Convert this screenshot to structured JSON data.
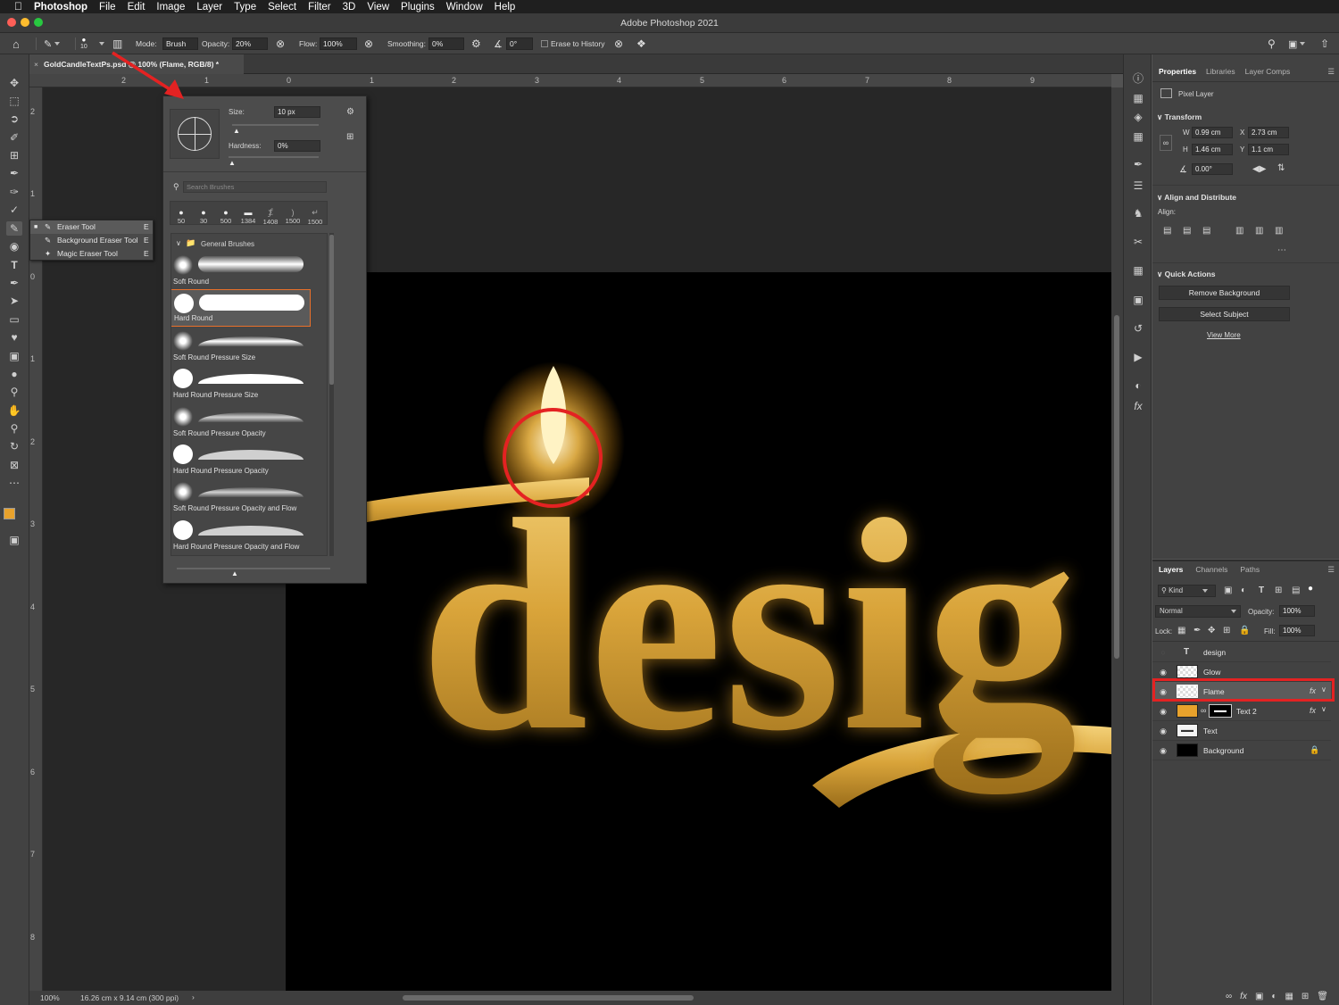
{
  "menubar": {
    "app": "Photoshop",
    "items": [
      "File",
      "Edit",
      "Image",
      "Layer",
      "Type",
      "Select",
      "Filter",
      "3D",
      "View",
      "Plugins",
      "Window",
      "Help"
    ]
  },
  "titlebar": {
    "title": "Adobe Photoshop 2021"
  },
  "options": {
    "brush_size": "10",
    "mode_label": "Mode:",
    "mode_value": "Brush",
    "opacity_label": "Opacity:",
    "opacity_value": "20%",
    "flow_label": "Flow:",
    "flow_value": "100%",
    "smoothing_label": "Smoothing:",
    "smoothing_value": "0%",
    "angle_value": "0°",
    "erase_history_label": "Erase to History"
  },
  "document": {
    "tab_label": "GoldCandleTextPs.psd @ 100% (Flame, RGB/8) *",
    "zoom": "100%",
    "status": "16.26 cm x 9.14 cm (300 ppi)",
    "artwork_text": "desig"
  },
  "rulers": {
    "h_labels": [
      "2",
      "1",
      "0",
      "1",
      "2",
      "3",
      "4",
      "5",
      "6",
      "7",
      "8",
      "9"
    ],
    "v_labels": [
      "2",
      "1",
      "0",
      "1",
      "2",
      "3",
      "4",
      "5",
      "6",
      "7",
      "8"
    ]
  },
  "eraser_flyout": [
    {
      "label": "Eraser Tool",
      "key": "E",
      "active": true
    },
    {
      "label": "Background Eraser Tool",
      "key": "E",
      "active": false
    },
    {
      "label": "Magic Eraser Tool",
      "key": "E",
      "active": false
    }
  ],
  "brush_picker": {
    "size_label": "Size:",
    "size_value": "10 px",
    "hardness_label": "Hardness:",
    "hardness_value": "0%",
    "search_placeholder": "Search Brushes",
    "recent_sizes": [
      "50",
      "30",
      "500",
      "1384",
      "1408",
      "1500",
      "1500"
    ],
    "folder": "General Brushes",
    "brushes": [
      {
        "name": "Soft Round",
        "selected": false
      },
      {
        "name": "Hard Round",
        "selected": true
      },
      {
        "name": "Soft Round Pressure Size",
        "selected": false
      },
      {
        "name": "Hard Round Pressure Size",
        "selected": false
      },
      {
        "name": "Soft Round Pressure Opacity",
        "selected": false
      },
      {
        "name": "Hard Round Pressure Opacity",
        "selected": false
      },
      {
        "name": "Soft Round Pressure Opacity and Flow",
        "selected": false
      },
      {
        "name": "Hard Round Pressure Opacity and Flow",
        "selected": false
      }
    ]
  },
  "properties": {
    "tabs": [
      "Properties",
      "Libraries",
      "Layer Comps"
    ],
    "layer_type": "Pixel Layer",
    "transform_title": "Transform",
    "w_label": "W",
    "w_value": "0.99 cm",
    "x_label": "X",
    "x_value": "2.73 cm",
    "h_label": "H",
    "h_value": "1.46 cm",
    "y_label": "Y",
    "y_value": "1.1 cm",
    "angle_value": "0.00°",
    "align_title": "Align and Distribute",
    "align_label": "Align:",
    "quick_title": "Quick Actions",
    "remove_bg": "Remove Background",
    "select_subject": "Select Subject",
    "view_more": "View More"
  },
  "layers_panel": {
    "tabs": [
      "Layers",
      "Channels",
      "Paths"
    ],
    "kind_label": "Kind",
    "blend_mode": "Normal",
    "opacity_label": "Opacity:",
    "opacity_value": "100%",
    "lock_label": "Lock:",
    "fill_label": "Fill:",
    "fill_value": "100%",
    "layers": [
      {
        "name": "design",
        "visible": false,
        "fx": false
      },
      {
        "name": "Glow",
        "visible": true,
        "fx": false
      },
      {
        "name": "Flame",
        "visible": true,
        "fx": true
      },
      {
        "name": "Text 2",
        "visible": true,
        "fx": true
      },
      {
        "name": "Text",
        "visible": true,
        "fx": false
      },
      {
        "name": "Background",
        "visible": true,
        "fx": false
      }
    ]
  },
  "colors": {
    "foreground": "#e8a22c",
    "background": "#000000",
    "highlight": "#e42222",
    "gold": "#d9a43a"
  }
}
